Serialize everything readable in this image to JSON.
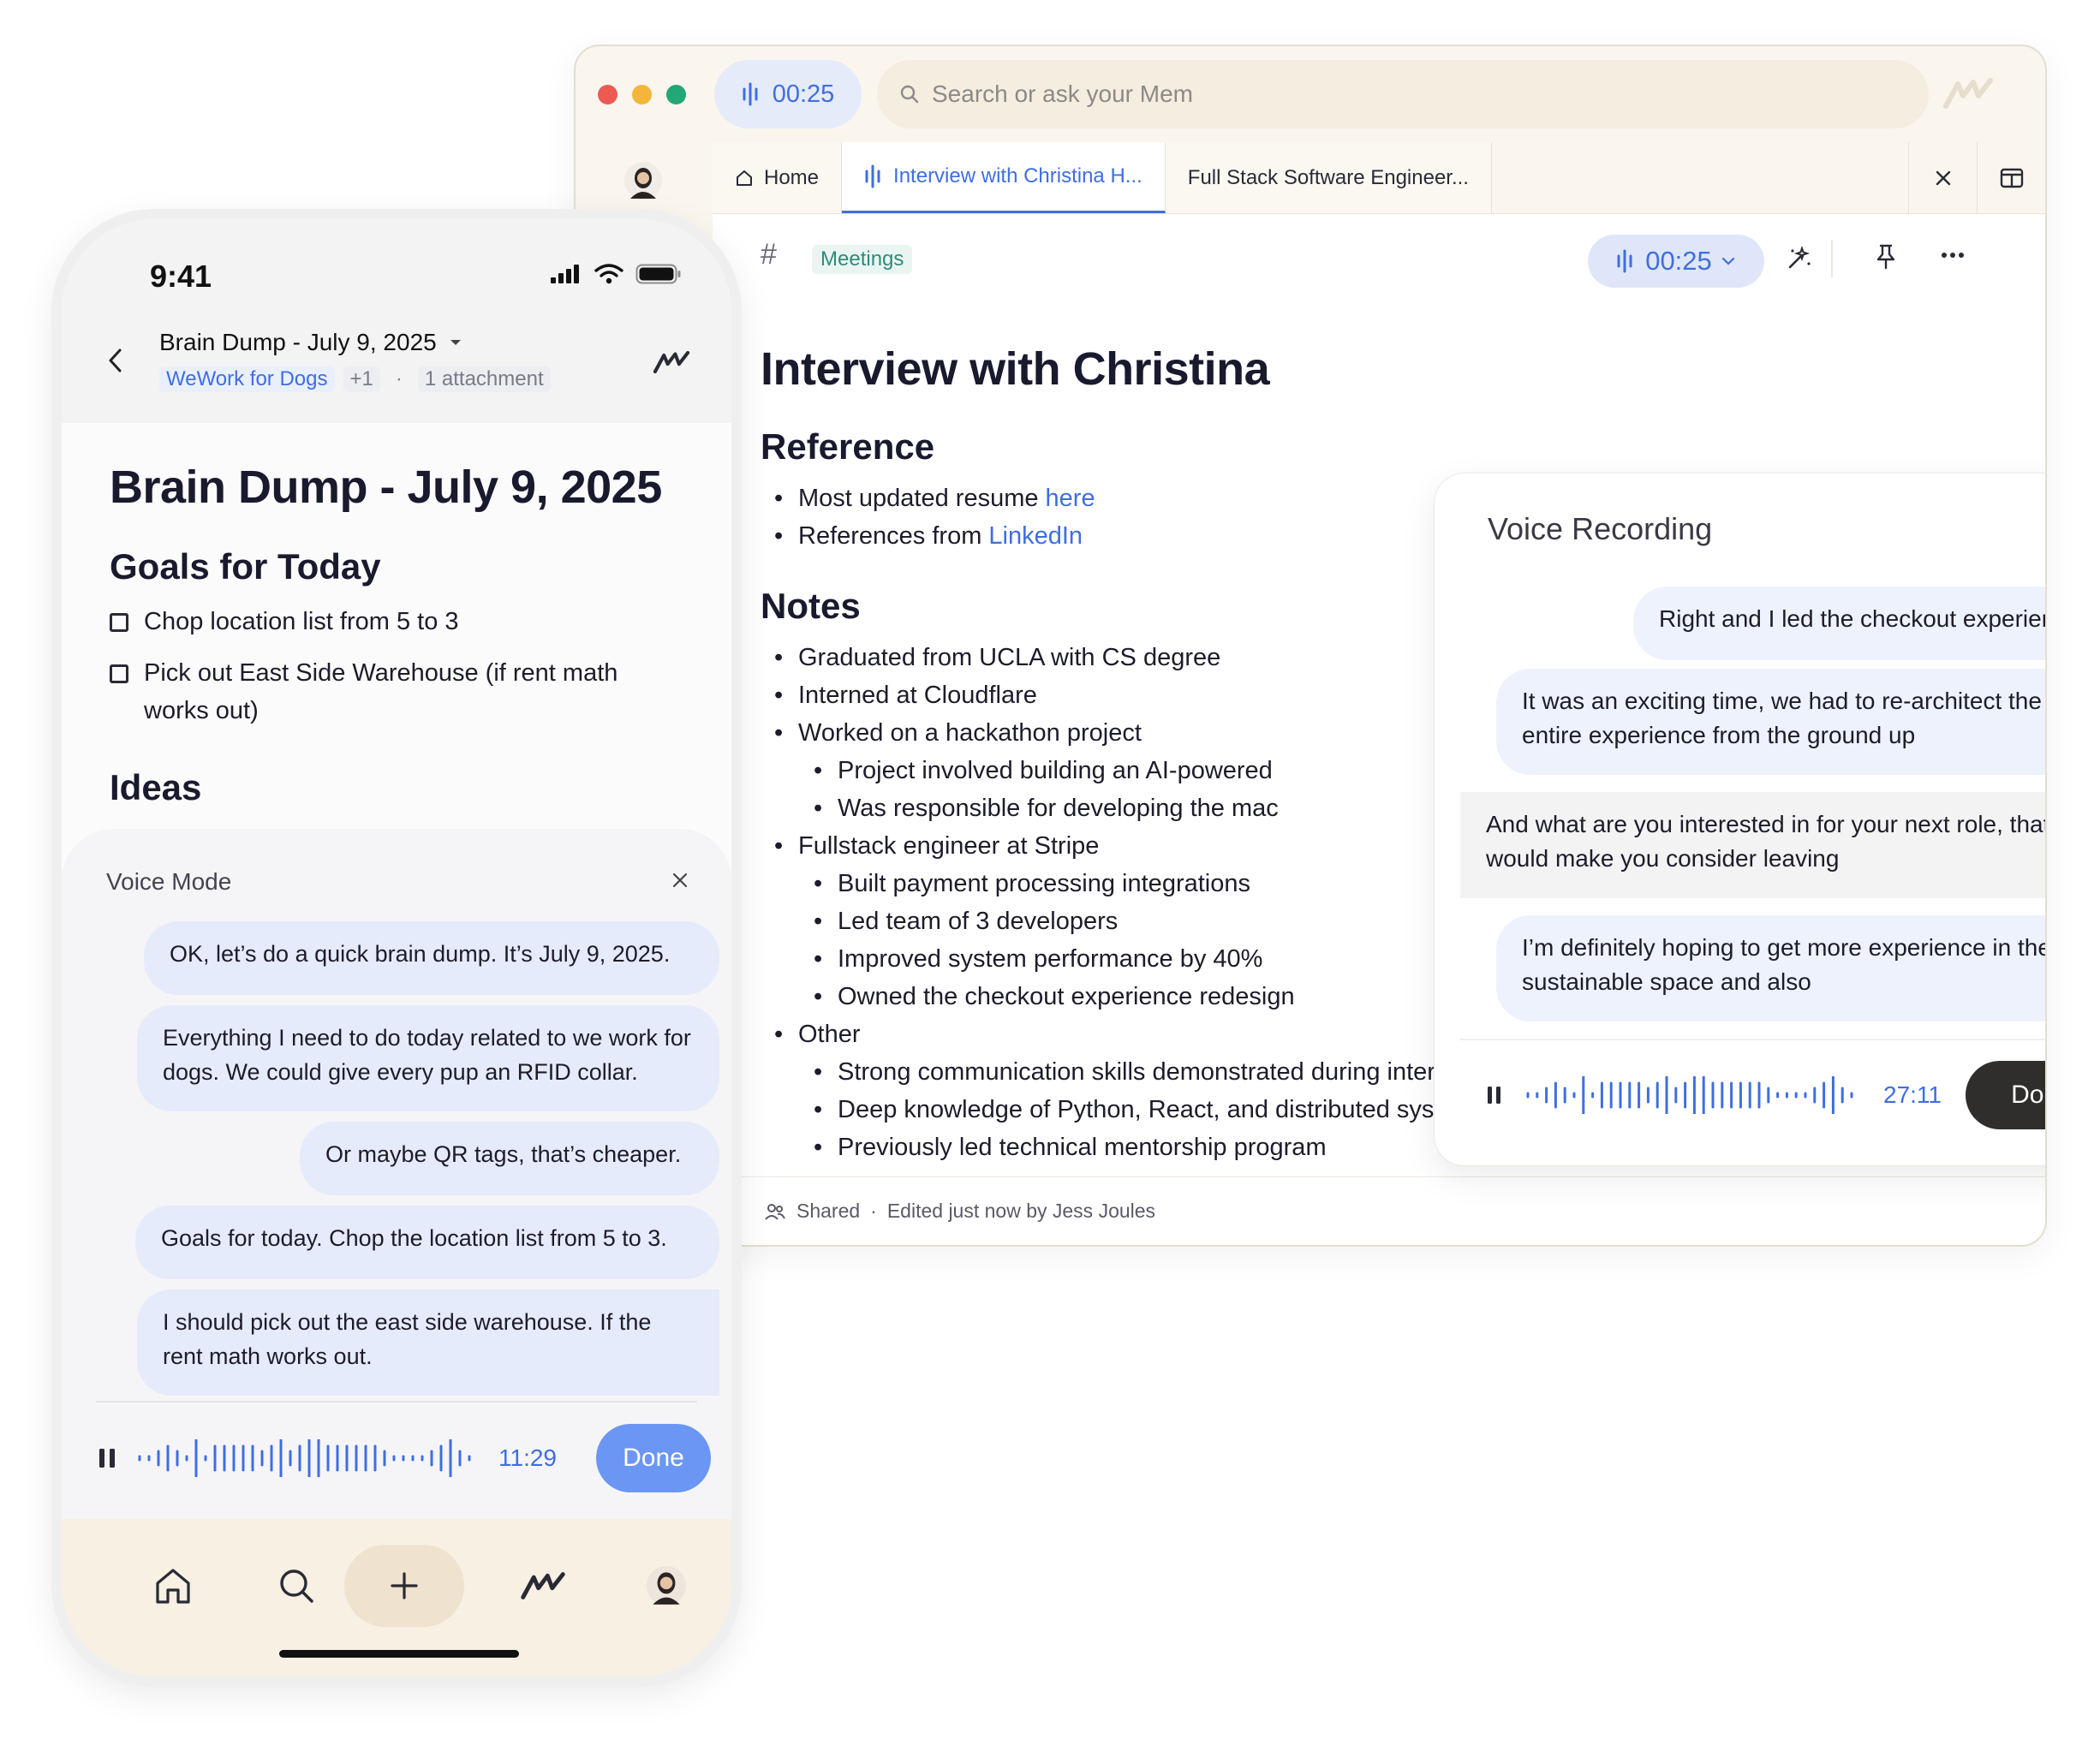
{
  "desktop": {
    "recording_time": "00:25",
    "search_placeholder": "Search or ask your Mem",
    "tabs": [
      {
        "label": "Home"
      },
      {
        "label": "Interview with Christina H..."
      },
      {
        "label": "Full Stack Software Engineer..."
      }
    ],
    "doc": {
      "tag": "Meetings",
      "recording_time": "00:25",
      "title": "Interview with Christina",
      "reference_heading": "Reference",
      "reference_items": [
        {
          "text": "Most updated resume ",
          "link": "here"
        },
        {
          "text": "References from ",
          "link": "LinkedIn"
        }
      ],
      "notes_heading": "Notes",
      "notes": [
        "Graduated from UCLA with CS degree",
        "Interned at Cloudflare",
        "Worked on a hackathon project",
        "Project involved building an AI-powered",
        "Was responsible for developing the mac",
        "Fullstack engineer at Stripe",
        "Built payment processing integrations",
        "Led team of 3 developers",
        "Improved system performance by 40%",
        "Owned the checkout experience redesign",
        "Other",
        "Strong communication skills demonstrated during interview",
        "Deep knowledge of Python, React, and distributed systems",
        "Previously led technical mentorship program"
      ],
      "footer_shared": "Shared",
      "footer_sep": "·",
      "footer_edited": "Edited just now by Jess Joules"
    },
    "voice_recording": {
      "title": "Voice Recording",
      "messages": [
        "Right and I led the checkout experience",
        "It was an exciting time, we had to re-architect the entire experience from the ground up",
        "And what are you interested in for your next role, that would make you consider leaving",
        "I’m definitely hoping to get more experience in the sustainable space and also"
      ],
      "time": "27:11",
      "done_label": "Done"
    }
  },
  "phone": {
    "status_time": "9:41",
    "header_title": "Brain Dump - July 9, 2025",
    "meta_tag": "WeWork for Dogs",
    "meta_more": "+1",
    "meta_sep": "·",
    "meta_attachment": "1 attachment",
    "title": "Brain Dump - July 9, 2025",
    "goals_heading": "Goals for Today",
    "goals": [
      "Chop location list from 5 to 3",
      "Pick out East Side Warehouse (if rent math works out)"
    ],
    "ideas_heading": "Ideas",
    "voice_mode": {
      "title": "Voice Mode",
      "messages": [
        "OK, let’s do a quick brain dump. It’s July 9, 2025.",
        "Everything I need to do today related to we work for dogs. We could give every pup an RFID collar.",
        "Or maybe QR tags, that’s cheaper.",
        "Goals for today. Chop the location list from 5 to 3.",
        "I should pick out the east side warehouse. If the rent math works out."
      ],
      "time": "11:29",
      "done_label": "Done"
    }
  },
  "colors": {
    "accent_blue": "#3f6ee0",
    "done_blue": "#6b96f4",
    "done_dark": "#2f2e2c",
    "traffic_red": "#ee5a52",
    "traffic_yellow": "#f3b63a",
    "traffic_green": "#22a776"
  }
}
